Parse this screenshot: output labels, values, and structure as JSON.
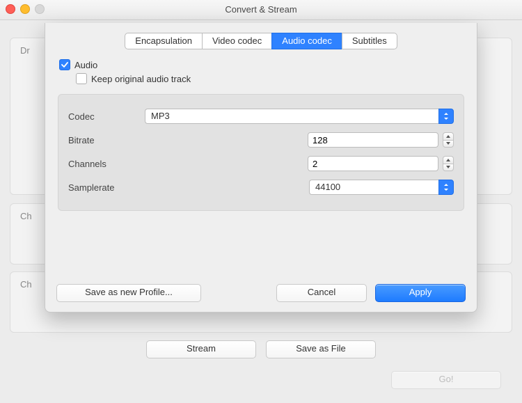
{
  "window": {
    "title": "Convert & Stream"
  },
  "bg": {
    "panel1_prefix": "Dr",
    "panel2_prefix": "Ch",
    "panel3_prefix": "Ch",
    "stream": "Stream",
    "save_as_file": "Save as File",
    "go": "Go!"
  },
  "tabs": {
    "encapsulation": "Encapsulation",
    "video": "Video codec",
    "audio": "Audio codec",
    "subtitles": "Subtitles"
  },
  "checks": {
    "audio": "Audio",
    "keep_original": "Keep original audio track"
  },
  "form": {
    "codec_label": "Codec",
    "codec_value": "MP3",
    "bitrate_label": "Bitrate",
    "bitrate_value": "128",
    "channels_label": "Channels",
    "channels_value": "2",
    "samplerate_label": "Samplerate",
    "samplerate_value": "44100"
  },
  "footer": {
    "save_profile": "Save as new Profile...",
    "cancel": "Cancel",
    "apply": "Apply"
  }
}
